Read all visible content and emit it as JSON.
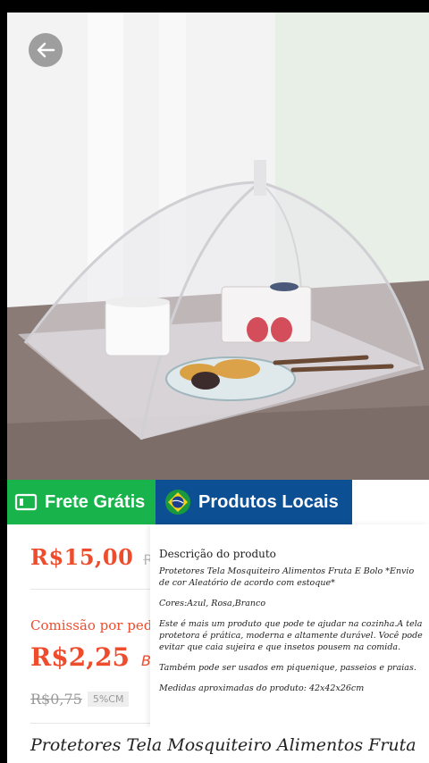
{
  "header": {
    "back_icon": "arrow-left-icon"
  },
  "banner": {
    "free_shipping_label": "Frete Grátis",
    "free_shipping_icon": "truck-card-icon",
    "local_products_label": "Produtos Locais",
    "local_products_icon": "brazil-flag-icon",
    "colors": {
      "green": "#19b34b",
      "blue": "#0d4f93"
    }
  },
  "pricing": {
    "price": "R$15,00",
    "price_cut": "R:",
    "commission_label": "Comissão por ped",
    "commission_value": "R$2,25",
    "commission_cut": "B",
    "old_price": "R$0,75",
    "percent_badge": "5%CM",
    "accent_color": "#ee4d2d"
  },
  "description": {
    "title": "Descrição do produto",
    "lines": [
      "Protetores Tela Mosquiteiro Alimentos Fruta E Bolo *Envio de cor Aleatório de acordo com estoque*",
      "Cores:Azul, Rosa,Branco",
      "Este é mais um produto que pode te ajudar na cozinha.A tela protetora é prática, moderna e altamente durável. Você pode evitar que caia sujeira e que insetos pousem na comida.",
      "Também pode ser usados em piquenique, passeios e praias.",
      "Medidas aproximadas do produto: 42x42x26cm"
    ]
  },
  "product_title": "Protetores Tela Mosquiteiro Alimentos Fruta"
}
